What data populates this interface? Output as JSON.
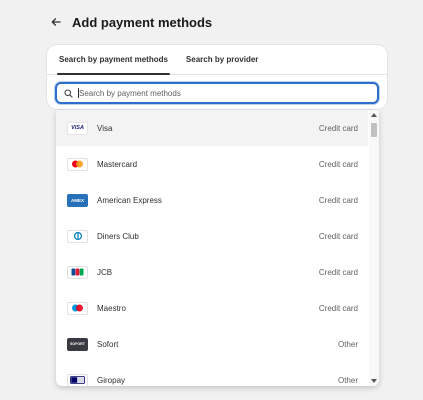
{
  "header": {
    "title": "Add payment methods"
  },
  "tabs": [
    {
      "label": "Search by payment methods",
      "active": true
    },
    {
      "label": "Search by provider",
      "active": false
    }
  ],
  "search": {
    "placeholder": "Search by payment methods",
    "value": ""
  },
  "methods": [
    {
      "name": "Visa",
      "type": "Credit card",
      "logo": "visa-logo",
      "highlighted": true
    },
    {
      "name": "Mastercard",
      "type": "Credit card",
      "logo": "mastercard-logo"
    },
    {
      "name": "American Express",
      "type": "Credit card",
      "logo": "amex-logo"
    },
    {
      "name": "Diners Club",
      "type": "Credit card",
      "logo": "diners-club-logo"
    },
    {
      "name": "JCB",
      "type": "Credit card",
      "logo": "jcb-logo"
    },
    {
      "name": "Maestro",
      "type": "Credit card",
      "logo": "maestro-logo"
    },
    {
      "name": "Sofort",
      "type": "Other",
      "logo": "sofort-logo"
    },
    {
      "name": "Giropay",
      "type": "Other",
      "logo": "giropay-logo"
    }
  ],
  "logo_text": {
    "visa": "VISA",
    "amex": "AMEX",
    "sofort": "SOFORT",
    "jcb": "JCB"
  },
  "colors": {
    "focus_ring": "#2c6ecb",
    "visa_blue": "#1a1f71",
    "amex_blue": "#2671b9",
    "mastercard_red": "#eb001b",
    "mastercard_orange": "#f79e1b",
    "maestro_blue": "#0099df"
  }
}
